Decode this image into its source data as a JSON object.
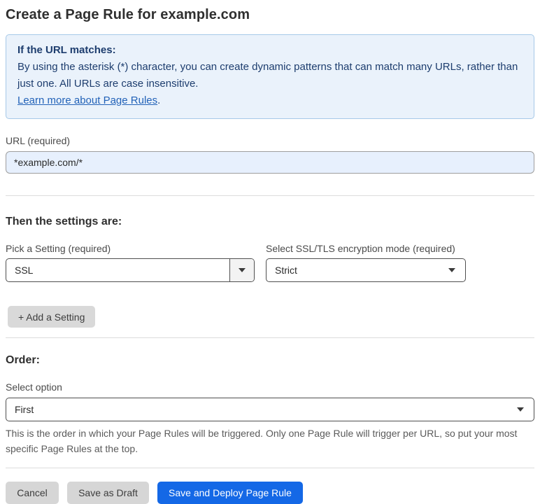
{
  "page": {
    "title": "Create a Page Rule for example.com"
  },
  "info_box": {
    "heading": "If the URL matches:",
    "body": "By using the asterisk (*) character, you can create dynamic patterns that can match many URLs, rather than just one. All URLs are case insensitive.",
    "link_text": "Learn more about Page Rules",
    "link_suffix": "."
  },
  "url_field": {
    "label": "URL (required)",
    "value": "*example.com/*"
  },
  "settings_section": {
    "heading": "Then the settings are:",
    "setting_picker": {
      "label": "Pick a Setting (required)",
      "value": "SSL"
    },
    "ssl_mode_picker": {
      "label": "Select SSL/TLS encryption mode (required)",
      "value": "Strict"
    },
    "add_setting_label": "+ Add a Setting"
  },
  "order_section": {
    "heading": "Order:",
    "select_label": "Select option",
    "value": "First",
    "help_text": "This is the order in which your Page Rules will be triggered. Only one Page Rule will trigger per URL, so put your most specific Page Rules at the top."
  },
  "footer": {
    "cancel_label": "Cancel",
    "save_draft_label": "Save as Draft",
    "save_deploy_label": "Save and Deploy Page Rule"
  },
  "colors": {
    "primary_button_blue": "#1468e6",
    "info_box_bg": "#eaf2fb",
    "info_box_border": "#a6c9e8",
    "info_box_text": "#1d3d6e",
    "link_blue": "#2262b8",
    "url_input_bg": "#e7f0fd",
    "gray_button_bg": "#d6d6d6",
    "select_border": "#4f4f4f",
    "divider": "#dcdcdc"
  }
}
